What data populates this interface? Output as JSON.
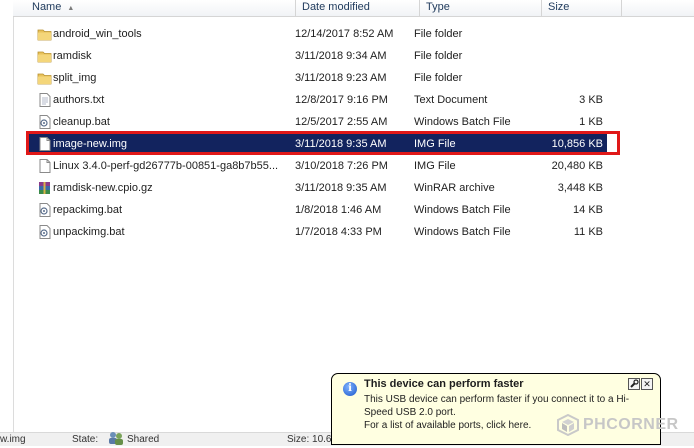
{
  "columns": {
    "name": "Name",
    "date": "Date modified",
    "type": "Type",
    "size": "Size"
  },
  "files": [
    {
      "name": "android_win_tools",
      "date": "12/14/2017 8:52 AM",
      "type": "File folder",
      "size": "",
      "icon": "folder-icon"
    },
    {
      "name": "ramdisk",
      "date": "3/11/2018 9:34 AM",
      "type": "File folder",
      "size": "",
      "icon": "folder-icon"
    },
    {
      "name": "split_img",
      "date": "3/11/2018 9:23 AM",
      "type": "File folder",
      "size": "",
      "icon": "folder-icon"
    },
    {
      "name": "authors.txt",
      "date": "12/8/2017 9:16 PM",
      "type": "Text Document",
      "size": "3 KB",
      "icon": "text-file-icon"
    },
    {
      "name": "cleanup.bat",
      "date": "12/5/2017 2:55 AM",
      "type": "Windows Batch File",
      "size": "1 KB",
      "icon": "batch-file-icon"
    },
    {
      "name": "image-new.img",
      "date": "3/11/2018 9:35 AM",
      "type": "IMG File",
      "size": "10,856 KB",
      "icon": "file-icon",
      "selected": true
    },
    {
      "name": "Linux 3.4.0-perf-gd26777b-00851-ga8b7b55...",
      "date": "3/10/2018 7:26 PM",
      "type": "IMG File",
      "size": "20,480 KB",
      "icon": "file-icon"
    },
    {
      "name": "ramdisk-new.cpio.gz",
      "date": "3/11/2018 9:35 AM",
      "type": "WinRAR archive",
      "size": "3,448 KB",
      "icon": "archive-icon"
    },
    {
      "name": "repackimg.bat",
      "date": "1/8/2018 1:46 AM",
      "type": "Windows Batch File",
      "size": "14 KB",
      "icon": "batch-file-icon"
    },
    {
      "name": "unpackimg.bat",
      "date": "1/7/2018 4:33 PM",
      "type": "Windows Batch File",
      "size": "11 KB",
      "icon": "batch-file-icon"
    }
  ],
  "status": {
    "filename": "w.img",
    "state_label": "State:",
    "state_value": "Shared",
    "size_label": "Size: 10.6 M"
  },
  "balloon": {
    "title": "This device can perform faster",
    "line1": "This USB device can perform faster if you connect it to a Hi-",
    "line2": "Speed USB 2.0 port.",
    "line3": "For a list of available ports, click here.",
    "close": "✕"
  },
  "watermark": "PHCORNER",
  "colors": {
    "selection": "#12235e",
    "highlight": "#e01818",
    "balloon_bg": "#ffffe1"
  }
}
